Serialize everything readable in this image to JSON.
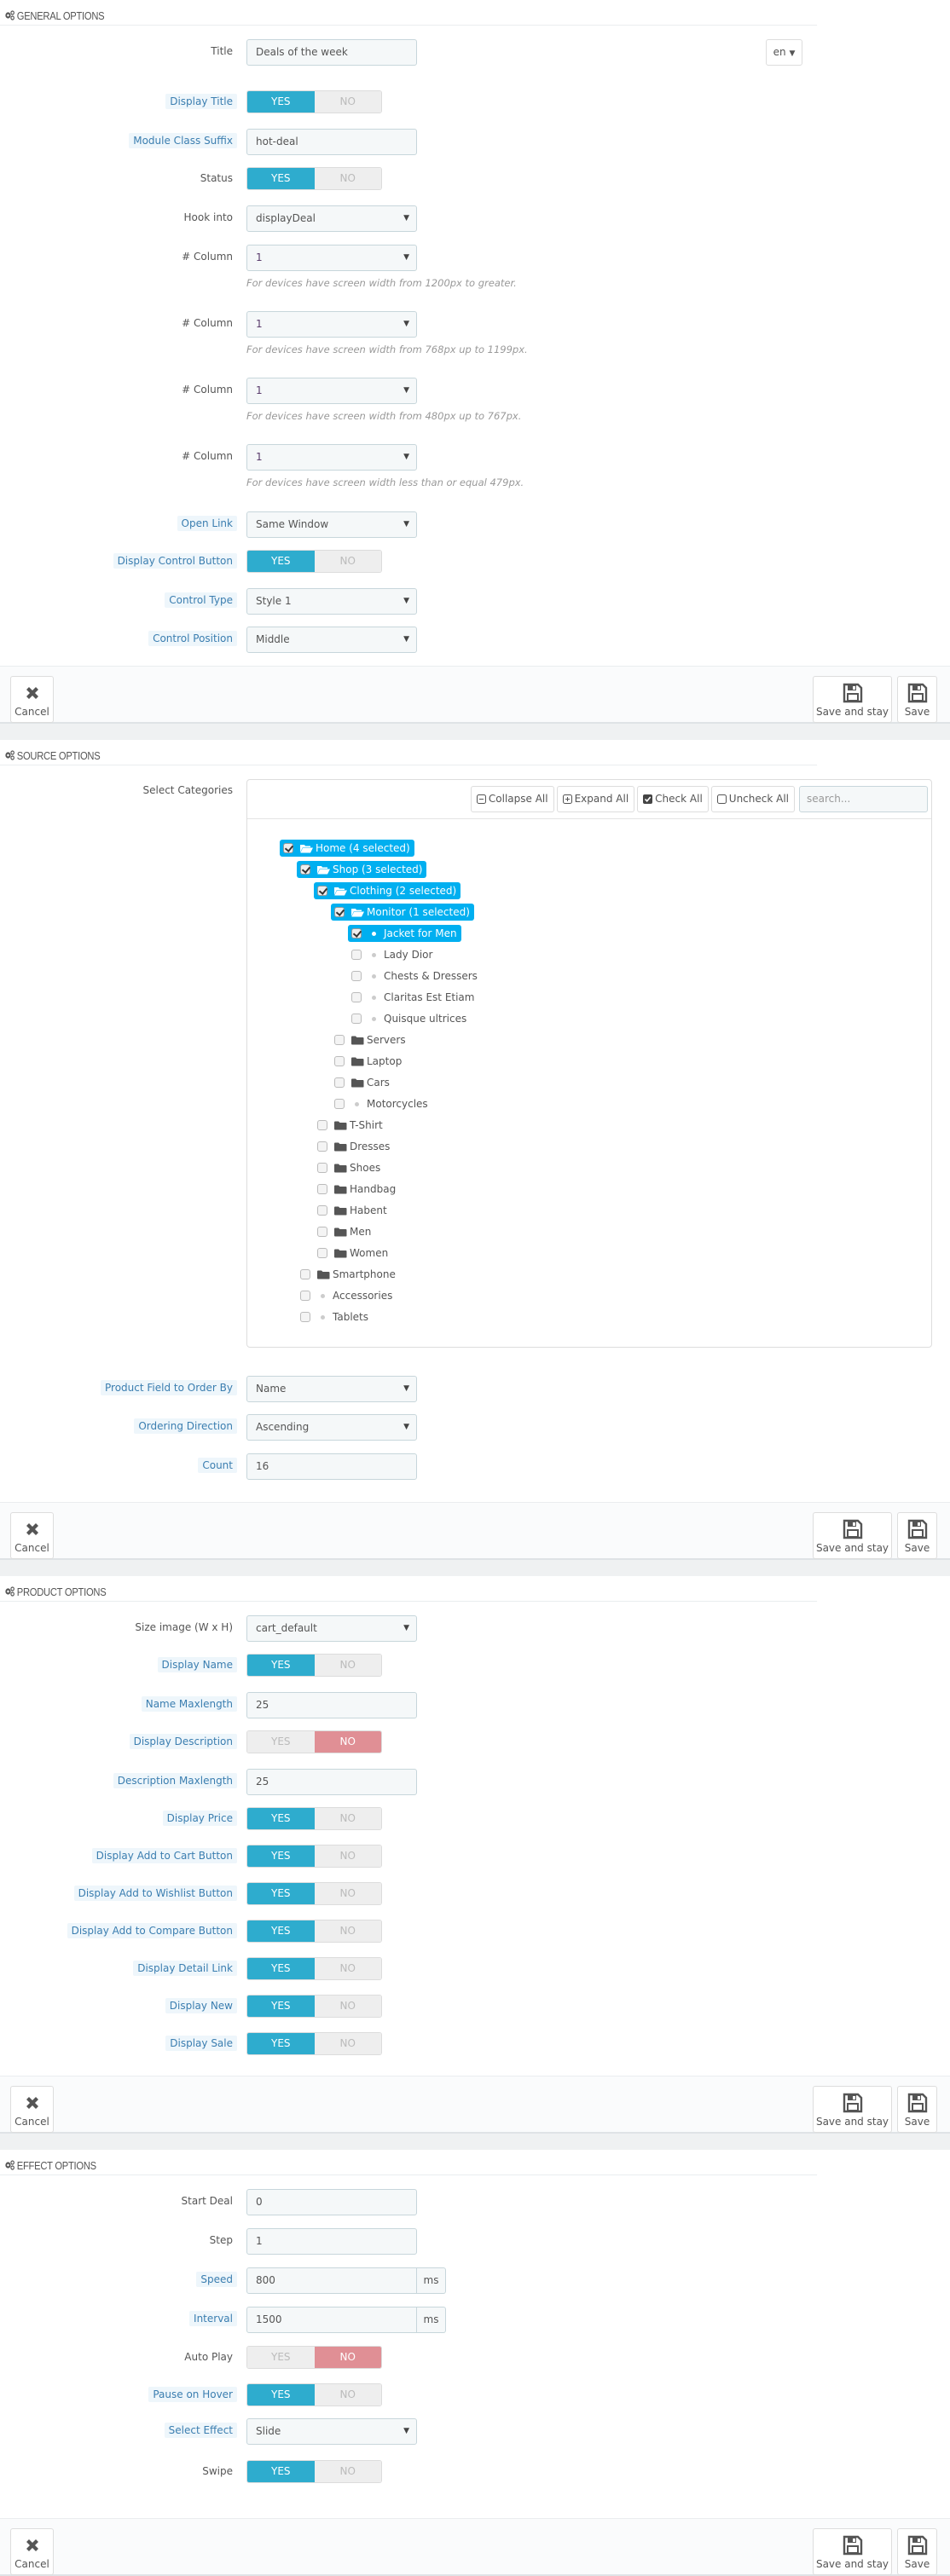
{
  "colors": {
    "accent": "#2eacce",
    "yes_on": "#2eacce",
    "no_on": "#e08f95",
    "tree_selected": "#00aff0",
    "hint_label": "#3b7eb0"
  },
  "footer": {
    "cancel": "Cancel",
    "save_and_stay": "Save and stay",
    "save": "Save"
  },
  "toggle": {
    "yes": "YES",
    "no": "NO"
  },
  "general": {
    "heading": "General Options",
    "title_label": "Title",
    "title_value": "Deals of the week",
    "lang": "en",
    "display_title_label": "Display Title",
    "display_title": "yes",
    "class_suffix_label": "Module Class Suffix",
    "class_suffix_value": "hot-deal",
    "status_label": "Status",
    "status": "yes",
    "hook_label": "Hook into",
    "hook_value": "displayDeal",
    "columns": [
      {
        "label": "# Column",
        "value": "1",
        "help": "For devices have screen width from 1200px to greater."
      },
      {
        "label": "# Column",
        "value": "1",
        "help": "For devices have screen width from 768px up to 1199px."
      },
      {
        "label": "# Column",
        "value": "1",
        "help": "For devices have screen width from 480px up to 767px."
      },
      {
        "label": "# Column",
        "value": "1",
        "help": "For devices have screen width less than or equal 479px."
      }
    ],
    "open_link_label": "Open Link",
    "open_link_value": "Same Window",
    "display_control_label": "Display Control Button",
    "display_control": "yes",
    "control_type_label": "Control Type",
    "control_type_value": "Style 1",
    "control_position_label": "Control Position",
    "control_position_value": "Middle"
  },
  "source": {
    "heading": "Source Options",
    "categories_label": "Select Categories",
    "toolbar": {
      "collapse": "Collapse All",
      "expand": "Expand All",
      "check": "Check All",
      "uncheck": "Uncheck All",
      "search_placeholder": "search..."
    },
    "tree": [
      {
        "label": "Home (4 selected)",
        "depth": 0,
        "type": "folder-open",
        "checked": true
      },
      {
        "label": "Shop (3 selected)",
        "depth": 1,
        "type": "folder-open",
        "checked": true
      },
      {
        "label": "Clothing (2 selected)",
        "depth": 2,
        "type": "folder-open",
        "checked": true
      },
      {
        "label": "Monitor (1 selected)",
        "depth": 3,
        "type": "folder-open",
        "checked": true
      },
      {
        "label": "Jacket for Men",
        "depth": 4,
        "type": "leaf",
        "checked": true
      },
      {
        "label": "Lady Dior",
        "depth": 4,
        "type": "leaf",
        "checked": false
      },
      {
        "label": "Chests & Dressers",
        "depth": 4,
        "type": "leaf",
        "checked": false
      },
      {
        "label": "Claritas Est Etiam",
        "depth": 4,
        "type": "leaf",
        "checked": false
      },
      {
        "label": "Quisque ultrices",
        "depth": 4,
        "type": "leaf",
        "checked": false
      },
      {
        "label": "Servers",
        "depth": 3,
        "type": "folder",
        "checked": false
      },
      {
        "label": "Laptop",
        "depth": 3,
        "type": "folder",
        "checked": false
      },
      {
        "label": "Cars",
        "depth": 3,
        "type": "folder",
        "checked": false
      },
      {
        "label": "Motorcycles",
        "depth": 3,
        "type": "leaf",
        "checked": false
      },
      {
        "label": "T-Shirt",
        "depth": 2,
        "type": "folder",
        "checked": false
      },
      {
        "label": "Dresses",
        "depth": 2,
        "type": "folder",
        "checked": false
      },
      {
        "label": "Shoes",
        "depth": 2,
        "type": "folder",
        "checked": false
      },
      {
        "label": "Handbag",
        "depth": 2,
        "type": "folder",
        "checked": false
      },
      {
        "label": "Habent",
        "depth": 2,
        "type": "folder",
        "checked": false
      },
      {
        "label": "Men",
        "depth": 2,
        "type": "folder",
        "checked": false
      },
      {
        "label": "Women",
        "depth": 2,
        "type": "folder",
        "checked": false
      },
      {
        "label": "Smartphone",
        "depth": 1,
        "type": "folder",
        "checked": false
      },
      {
        "label": "Accessories",
        "depth": 1,
        "type": "leaf",
        "checked": false
      },
      {
        "label": "Tablets",
        "depth": 1,
        "type": "leaf",
        "checked": false
      }
    ],
    "order_by_label": "Product Field to Order By",
    "order_by_value": "Name",
    "direction_label": "Ordering Direction",
    "direction_value": "Ascending",
    "count_label": "Count",
    "count_value": "16"
  },
  "product": {
    "heading": "Product Options",
    "size_label": "Size image (W x H)",
    "size_value": "cart_default",
    "display_name_label": "Display Name",
    "display_name": "yes",
    "name_max_label": "Name Maxlength",
    "name_max_value": "25",
    "display_desc_label": "Display Description",
    "display_desc": "no",
    "desc_max_label": "Description Maxlength",
    "desc_max_value": "25",
    "toggles": [
      {
        "label": "Display Price",
        "value": "yes"
      },
      {
        "label": "Display Add to Cart Button",
        "value": "yes"
      },
      {
        "label": "Display Add to Wishlist Button",
        "value": "yes"
      },
      {
        "label": "Display Add to Compare Button",
        "value": "yes"
      },
      {
        "label": "Display Detail Link",
        "value": "yes"
      },
      {
        "label": "Display New",
        "value": "yes"
      },
      {
        "label": "Display Sale",
        "value": "yes"
      }
    ]
  },
  "effect": {
    "heading": "Effect Options",
    "start_label": "Start Deal",
    "start_value": "0",
    "step_label": "Step",
    "step_value": "1",
    "speed_label": "Speed",
    "speed_value": "800",
    "interval_label": "Interval",
    "interval_value": "1500",
    "unit": "ms",
    "autoplay_label": "Auto Play",
    "autoplay": "no",
    "pause_label": "Pause on Hover",
    "pause": "yes",
    "effect_label": "Select Effect",
    "effect_value": "Slide",
    "swipe_label": "Swipe",
    "swipe": "yes"
  }
}
